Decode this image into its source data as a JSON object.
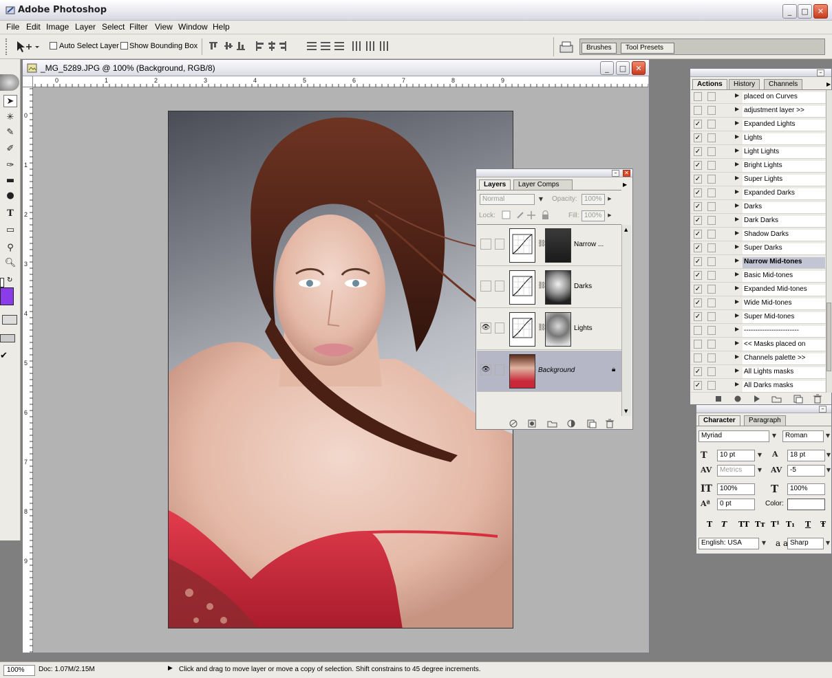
{
  "app": {
    "title": "Adobe Photoshop"
  },
  "menu": [
    "File",
    "Edit",
    "Image",
    "Layer",
    "Select",
    "Filter",
    "View",
    "Window",
    "Help"
  ],
  "options_bar": {
    "auto_select_label": "Auto Select Layer",
    "show_bounding_label": "Show Bounding Box",
    "well_tabs": [
      "Brushes",
      "Tool Presets"
    ]
  },
  "document": {
    "title": "_MG_5289.JPG @ 100% (Background, RGB/8)",
    "ruler_top": [
      "0",
      "1",
      "2",
      "3",
      "4",
      "5",
      "6",
      "7",
      "8",
      "9"
    ],
    "ruler_left": [
      "0",
      "1",
      "2",
      "3",
      "4",
      "5",
      "6",
      "7",
      "8",
      "9"
    ]
  },
  "layers_panel": {
    "tabs": [
      "Layers",
      "Layer Comps"
    ],
    "blend_mode": "Normal",
    "opacity_label": "Opacity:",
    "opacity_value": "100%",
    "lock_label": "Lock:",
    "fill_label": "Fill:",
    "fill_value": "100%",
    "layers": [
      {
        "name": "Narrow ...",
        "visible": false
      },
      {
        "name": "Darks",
        "visible": false
      },
      {
        "name": "Lights",
        "visible": true
      },
      {
        "name": "Background",
        "visible": true
      }
    ]
  },
  "actions_panel": {
    "tabs": [
      "Actions",
      "History",
      "Channels"
    ],
    "items": [
      {
        "label": "placed on Curves",
        "checked": false
      },
      {
        "label": "adjustment layer >>",
        "checked": false
      },
      {
        "label": "Expanded Lights",
        "checked": true
      },
      {
        "label": "Lights",
        "checked": true
      },
      {
        "label": "Light Lights",
        "checked": true
      },
      {
        "label": "Bright Lights",
        "checked": true
      },
      {
        "label": "Super Lights",
        "checked": true
      },
      {
        "label": "Expanded Darks",
        "checked": true
      },
      {
        "label": "Darks",
        "checked": true
      },
      {
        "label": "Dark Darks",
        "checked": true
      },
      {
        "label": "Shadow Darks",
        "checked": true
      },
      {
        "label": "Super Darks",
        "checked": true
      },
      {
        "label": "Narrow Mid-tones",
        "checked": true
      },
      {
        "label": "Basic Mid-tones",
        "checked": true
      },
      {
        "label": "Expanded Mid-tones",
        "checked": true
      },
      {
        "label": "Wide Mid-tones",
        "checked": true
      },
      {
        "label": "Super Mid-tones",
        "checked": true
      },
      {
        "label": "------------------------",
        "checked": false
      },
      {
        "label": "<< Masks placed on",
        "checked": false
      },
      {
        "label": "Channels palette >>",
        "checked": false
      },
      {
        "label": "All Lights masks",
        "checked": true
      },
      {
        "label": "All Darks masks",
        "checked": true
      }
    ]
  },
  "character_panel": {
    "tabs": [
      "Character",
      "Paragraph"
    ],
    "font_family": "Myriad",
    "font_style": "Roman",
    "font_size": "10 pt",
    "leading": "18 pt",
    "kerning": "Metrics",
    "tracking": "-5",
    "vertical_scale": "100%",
    "horizontal_scale": "100%",
    "baseline_shift": "0 pt",
    "color_label": "Color:",
    "language": "English: USA",
    "antialias_icon": "a a",
    "antialias": "Sharp",
    "style_buttons": [
      "T",
      "T",
      "TT",
      "Tт",
      "T¹",
      "T₁",
      "T",
      "Ŧ"
    ]
  },
  "status_bar": {
    "zoom": "100%",
    "doc_size": "Doc: 1.07M/2.15M",
    "hint": "Click and drag to move layer or move a copy of selection. Shift constrains to 45 degree increments."
  },
  "colors": {
    "foreground": "#8a3ce8",
    "dress": "#c8283a",
    "hair": "#5a2a1a",
    "selection": "#b5b7c6"
  }
}
